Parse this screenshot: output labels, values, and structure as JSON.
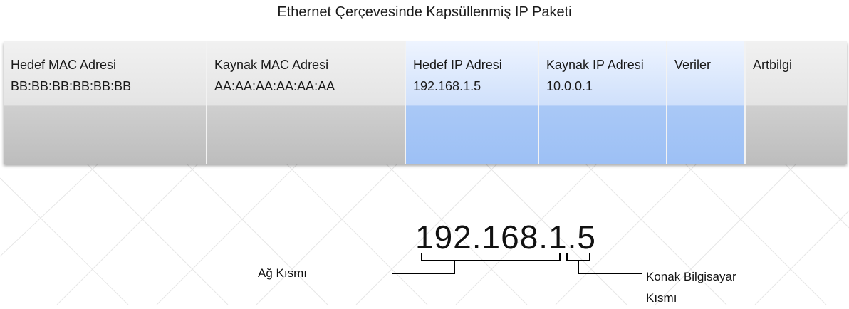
{
  "title": "Ethernet Çerçevesinde Kapsüllenmiş IP Paketi",
  "fields": [
    {
      "label": "Hedef MAC Adresi",
      "value": "BB:BB:BB:BB:BB:BB"
    },
    {
      "label": "Kaynak MAC Adresi",
      "value": "AA:AA:AA:AA:AA:AA"
    },
    {
      "label": "Hedef IP Adresi",
      "value": "192.168.1.5"
    },
    {
      "label": "Kaynak IP Adresi",
      "value": "10.0.0.1"
    },
    {
      "label": "Veriler",
      "value": ""
    },
    {
      "label": "Artbilgi",
      "value": ""
    }
  ],
  "colors": {
    "ip_field": "#a9c8f6",
    "frame_field": "#cfcfcf",
    "line": "#000000"
  },
  "address": {
    "full": "192.168.1.5",
    "network_label": "Ağ Kısmı",
    "host_label_line1": "Konak Bilgisayar",
    "host_label_line2": "Kısmı"
  }
}
